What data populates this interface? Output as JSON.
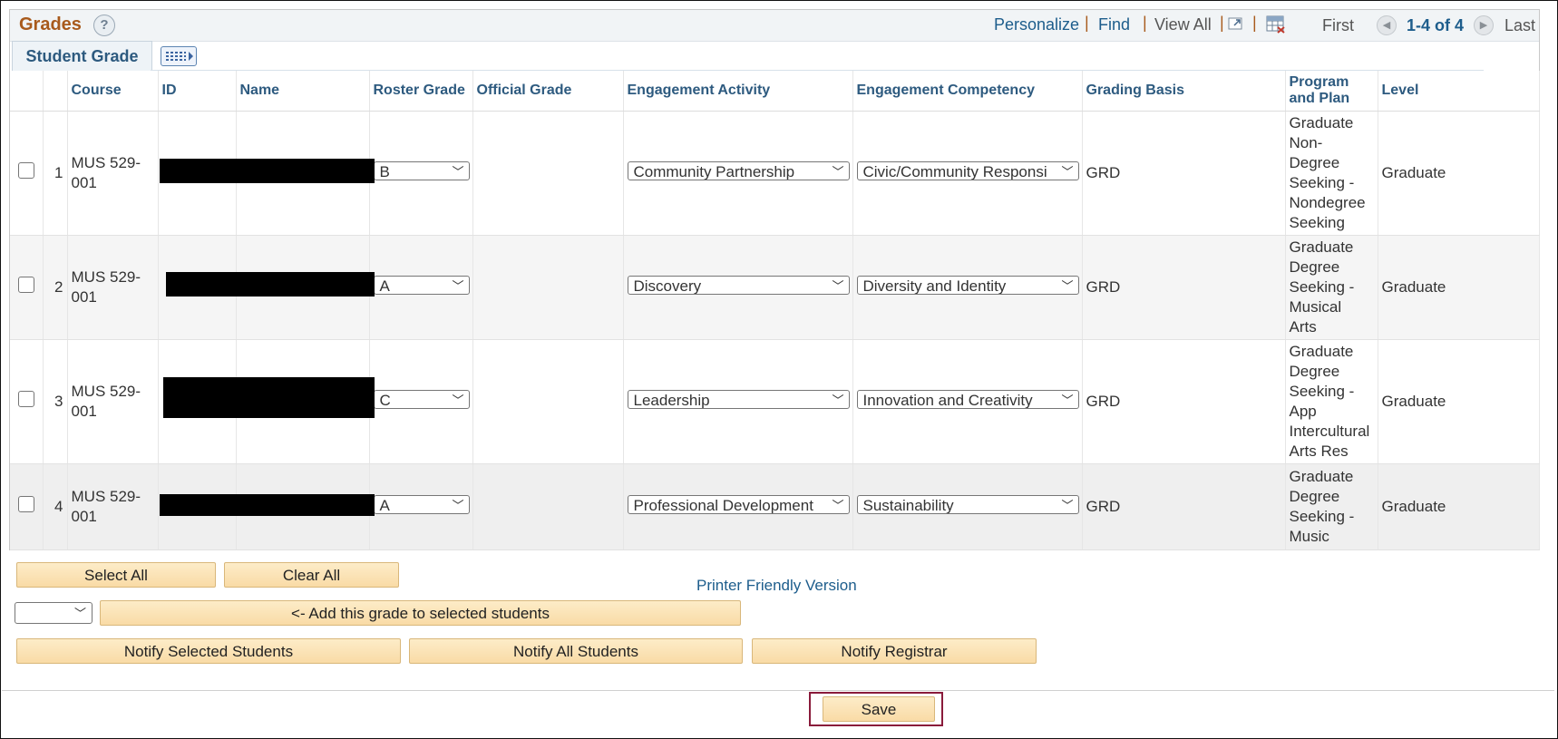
{
  "header": {
    "title": "Grades",
    "help_icon": "?",
    "personalize": "Personalize",
    "find": "Find",
    "view_all": "View All",
    "first": "First",
    "page_info": "1-4 of 4",
    "last": "Last",
    "separator": "|"
  },
  "tabs": {
    "active": "Student Grade"
  },
  "columns": [
    "",
    "",
    "Course",
    "ID",
    "Name",
    "Roster Grade",
    "Official Grade",
    "Engagement Activity",
    "Engagement Competency",
    "Grading Basis",
    "Program and Plan",
    "Level"
  ],
  "column_labels": {
    "course": "Course",
    "id": "ID",
    "name": "Name",
    "roster": "Roster Grade",
    "official": "Official Grade",
    "activity": "Engagement Activity",
    "competency": "Engagement Competency",
    "basis": "Grading Basis",
    "program_1": "Program",
    "program_2": "and Plan",
    "level": "Level"
  },
  "rows": [
    {
      "num": "1",
      "course_1": "MUS 529-",
      "course_2": "001",
      "roster_grade": "B",
      "activity": "Community Partnership",
      "competency": "Civic/Community Responsi",
      "grading_basis": "GRD",
      "program": [
        "Graduate",
        "Non-",
        "Degree",
        "Seeking -",
        "Nondegree",
        "Seeking"
      ],
      "level": "Graduate"
    },
    {
      "num": "2",
      "course_1": "MUS 529-",
      "course_2": "001",
      "roster_grade": "A",
      "activity": "Discovery",
      "competency": "Diversity and Identity",
      "grading_basis": "GRD",
      "program": [
        "Graduate",
        "Degree",
        "Seeking -",
        "Musical",
        "Arts"
      ],
      "level": "Graduate"
    },
    {
      "num": "3",
      "course_1": "MUS 529-",
      "course_2": "001",
      "roster_grade": "C",
      "activity": "Leadership",
      "competency": "Innovation and Creativity",
      "grading_basis": "GRD",
      "program": [
        "Graduate",
        "Degree",
        "Seeking -",
        "App",
        "Intercultural",
        "Arts Res"
      ],
      "level": "Graduate"
    },
    {
      "num": "4",
      "course_1": "MUS 529-",
      "course_2": "001",
      "roster_grade": "A",
      "activity": "Professional Development",
      "competency": "Sustainability",
      "grading_basis": "GRD",
      "program": [
        "Graduate",
        "Degree",
        "Seeking -",
        "Music"
      ],
      "level": "Graduate"
    }
  ],
  "actions": {
    "select_all": "Select All",
    "clear_all": "Clear All",
    "printer_friendly": "Printer Friendly Version",
    "add_grade": "<- Add this grade to selected students",
    "notify_selected": "Notify Selected Students",
    "notify_all": "Notify All Students",
    "notify_registrar": "Notify Registrar",
    "save": "Save"
  },
  "colors": {
    "title": "#a85a1c",
    "link": "#1d5d8c",
    "header_text": "#2d5a7f",
    "button_bg": "#f9dba6",
    "highlight_border": "#8a1b3b"
  }
}
